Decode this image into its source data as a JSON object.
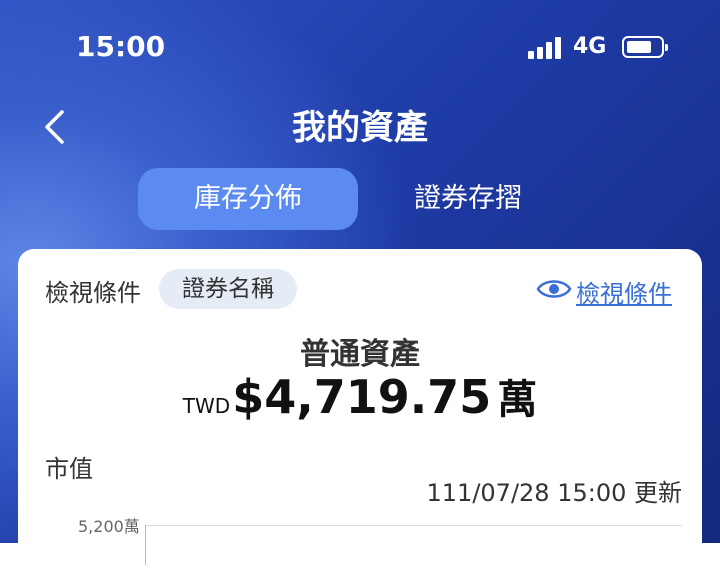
{
  "status_bar": {
    "time": "15:00",
    "network": "4G"
  },
  "header": {
    "title": "我的資產"
  },
  "tabs": [
    {
      "label": "庫存分佈",
      "active": true
    },
    {
      "label": "證券存摺",
      "active": false
    }
  ],
  "filter": {
    "label": "檢視條件",
    "chip": "證券名稱",
    "view_link": "檢視條件"
  },
  "asset": {
    "title": "普通資產",
    "currency": "TWD",
    "amount": "$4,719.75",
    "unit": "萬"
  },
  "chart": {
    "label": "市值",
    "updated": "111/07/28 15:00 更新",
    "y_tick": "5,200萬"
  },
  "colors": {
    "accent": "#5b8bf0",
    "link": "#3a6fd8",
    "header_dark": "#14297e"
  }
}
